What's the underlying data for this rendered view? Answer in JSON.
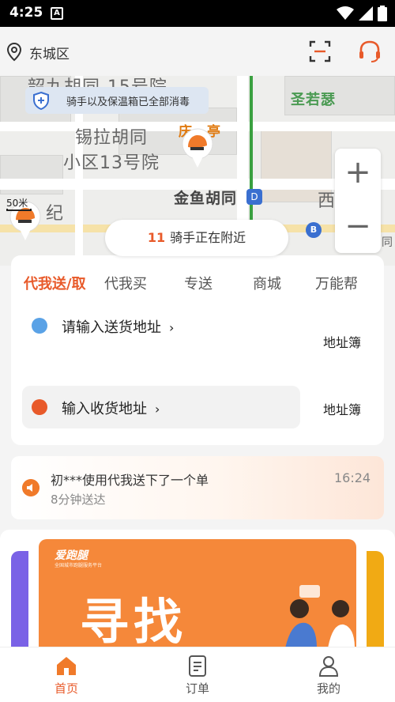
{
  "status_bar": {
    "time": "4:25",
    "notif_glyph": "A"
  },
  "header": {
    "location": "东城区"
  },
  "map": {
    "sanitize_notice": "骑手以及保温箱已全部消毒",
    "labels": {
      "top": "韶九胡同-15号院",
      "xila": "锡拉胡同",
      "xiaoqu": "小区13号院",
      "jinyu": "金鱼胡同",
      "shengruose": "圣若瑟",
      "qingjinting": "庆",
      "qingjinting2": "亭",
      "xi": "西",
      "ji": "纪",
      "hutong": "胡同"
    },
    "scale": "50米",
    "subway_glyph": "D",
    "bus_glyph": "B",
    "zoom_in": "+",
    "zoom_out": "−"
  },
  "nearby": {
    "count": "11",
    "text": "骑手正在附近"
  },
  "order": {
    "tabs": [
      "代我送/取",
      "代我买",
      "专送",
      "商城",
      "万能帮"
    ],
    "active_tab": 0,
    "send_placeholder": "请输入送货地址",
    "recv_placeholder": "输入收货地址",
    "chevron": "›",
    "address_book": "地址簿"
  },
  "notice": {
    "title": "初***使用代我送下了一个单",
    "subtitle": "8分钟送达",
    "time": "16:24"
  },
  "banner": {
    "brand": "爱跑腿",
    "brand_sub": "全国城市跑腿服务平台",
    "headline": "寻找"
  },
  "bottom_nav": [
    {
      "label": "首页",
      "icon": "home-icon",
      "active": true
    },
    {
      "label": "订单",
      "icon": "orders-icon",
      "active": false
    },
    {
      "label": "我的",
      "icon": "profile-icon",
      "active": false
    }
  ],
  "colors": {
    "accent": "#e85a2a",
    "send_pin": "#5aa2e6",
    "recv_pin": "#e85a2a"
  }
}
